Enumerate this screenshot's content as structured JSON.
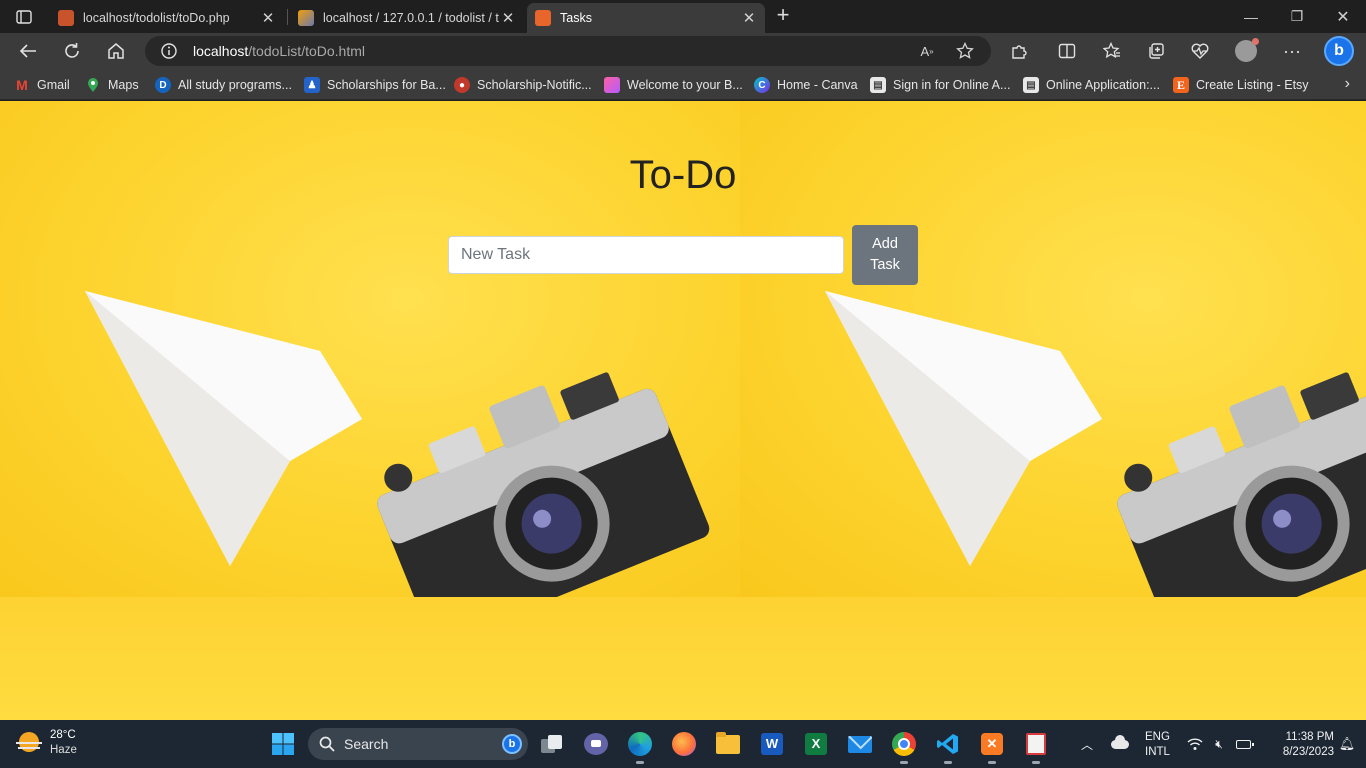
{
  "browser": {
    "tabs": [
      {
        "title": "localhost/todolist/toDo.php",
        "icon": "xampp-icon",
        "active": false
      },
      {
        "title": "localhost / 127.0.0.1 / todolist / t",
        "icon": "phpmyadmin-icon",
        "active": false
      },
      {
        "title": "Tasks",
        "icon": "xampp-icon",
        "active": true
      }
    ],
    "address": {
      "host": "localhost",
      "path": "/todoList/toDo.html"
    },
    "bookmarks": [
      {
        "label": "Gmail",
        "icon": "gmail-icon"
      },
      {
        "label": "Maps",
        "icon": "maps-icon"
      },
      {
        "label": "All study programs...",
        "icon": "daad-icon"
      },
      {
        "label": "Scholarships for Ba...",
        "icon": "scholarship-icon"
      },
      {
        "label": "Scholarship-Notific...",
        "icon": "notification-icon"
      },
      {
        "label": "Welcome to your B...",
        "icon": "welcome-icon"
      },
      {
        "label": "Home - Canva",
        "icon": "canva-icon"
      },
      {
        "label": "Sign in for Online A...",
        "icon": "signin-icon"
      },
      {
        "label": "Online Application:...",
        "icon": "application-icon"
      },
      {
        "label": "Create Listing - Etsy",
        "icon": "etsy-icon"
      }
    ]
  },
  "page": {
    "title": "To-Do",
    "input_placeholder": "New Task",
    "add_button_line1": "Add",
    "add_button_line2": "Task"
  },
  "taskbar": {
    "weather_temp": "28°C",
    "weather_condition": "Haze",
    "search_label": "Search",
    "lang_line1": "ENG",
    "lang_line2": "INTL",
    "time": "11:38 PM",
    "date": "8/23/2023"
  },
  "colors": {
    "page_background": "#fdd23a",
    "button": "#6c757d",
    "taskbar": "#1c2733"
  }
}
